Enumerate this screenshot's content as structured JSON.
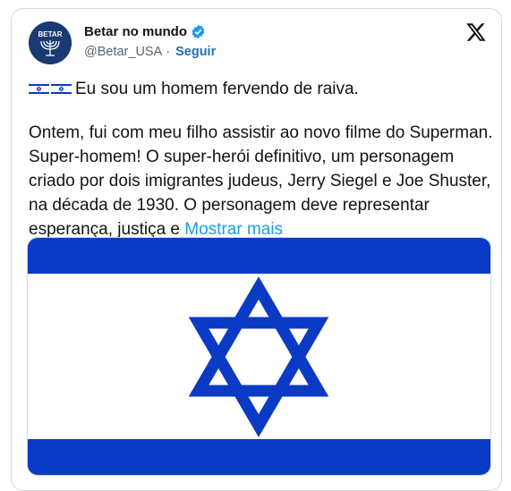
{
  "author": {
    "name": "Betar no mundo",
    "handle": "@Betar_USA",
    "separator": "·",
    "follow_label": "Seguir",
    "avatar_text": "BETAR",
    "verified": true
  },
  "post": {
    "first_line": "Eu sou um homem fervendo de raiva.",
    "body": "Ontem, fui com meu filho assistir ao novo filme do Superman. Super-homem! O super-herói definitivo, um personagem criado por dois imigrantes judeus, Jerry Siegel e Joe Shuster, na década de 1930. O personagem deve representar esperança, justiça e ",
    "show_more": "Mostrar mais"
  },
  "media": {
    "description_icon": "israel-flag"
  },
  "colors": {
    "flag_blue": "#0b3bc4",
    "link": "#1d9bf0",
    "follow": "#1d6fb5",
    "verified": "#1d9bf0"
  }
}
